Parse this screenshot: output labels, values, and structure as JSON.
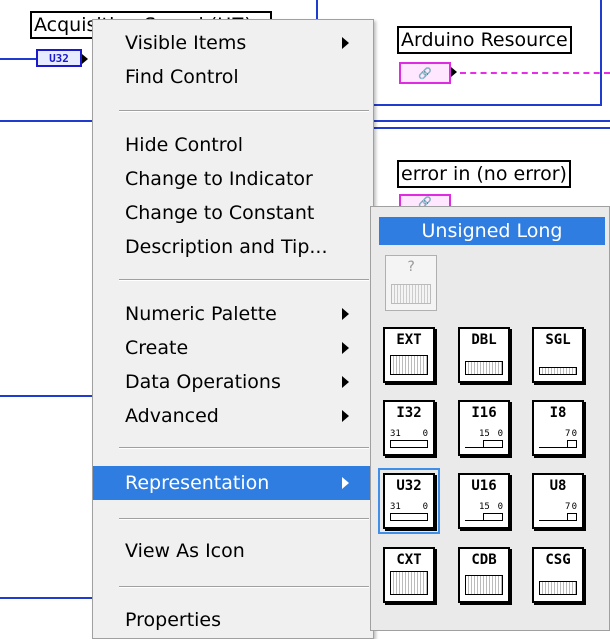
{
  "diagram": {
    "acq_label": "Acquisition Speed (HZ)",
    "acq_term": "U32",
    "arduino_label": "Arduino Resource",
    "arduino_term": "🔗",
    "error_label": "error in (no error)",
    "error_term": "🔗"
  },
  "menu": {
    "items": [
      {
        "label": "Visible Items",
        "submenu": true
      },
      {
        "label": "Find Control",
        "submenu": false
      },
      {
        "label": "Hide Control",
        "submenu": false
      },
      {
        "label": "Change to Indicator",
        "submenu": false
      },
      {
        "label": "Change to Constant",
        "submenu": false
      },
      {
        "label": "Description and Tip...",
        "submenu": false
      },
      {
        "label": "Numeric Palette",
        "submenu": true
      },
      {
        "label": "Create",
        "submenu": true
      },
      {
        "label": "Data Operations",
        "submenu": true
      },
      {
        "label": "Advanced",
        "submenu": true
      },
      {
        "label": "Representation",
        "submenu": true,
        "highlighted": true
      },
      {
        "label": "View As Icon",
        "submenu": false
      },
      {
        "label": "Properties",
        "submenu": false
      }
    ]
  },
  "palette": {
    "title": "Unsigned Long",
    "unknown_glyph": "?",
    "buttons": [
      {
        "label": "EXT"
      },
      {
        "label": "DBL"
      },
      {
        "label": "SGL"
      },
      {
        "label": "I32",
        "hi": "31",
        "lo": "0"
      },
      {
        "label": "I16",
        "hi": "15",
        "lo": "0"
      },
      {
        "label": "I8",
        "hi": "7",
        "lo": "0"
      },
      {
        "label": "U32",
        "hi": "31",
        "lo": "0",
        "selected": true
      },
      {
        "label": "U16",
        "hi": "15",
        "lo": "0"
      },
      {
        "label": "U8",
        "hi": "7",
        "lo": "0"
      },
      {
        "label": "CXT"
      },
      {
        "label": "CDB"
      },
      {
        "label": "CSG"
      }
    ]
  },
  "colors": {
    "highlight": "#2f7de1",
    "wire_numeric": "#1f3ccf",
    "wire_resource": "#e82ce8"
  }
}
